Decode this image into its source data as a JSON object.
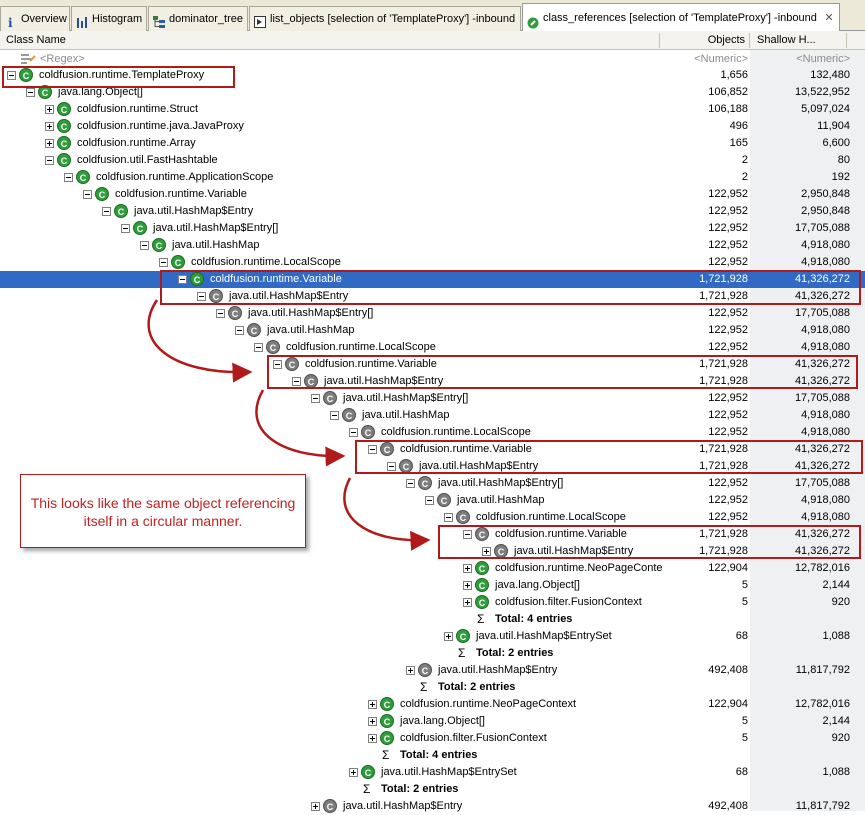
{
  "tabs": [
    {
      "label": "Overview",
      "icon": "info-icon"
    },
    {
      "label": "Histogram",
      "icon": "histogram-icon"
    },
    {
      "label": "dominator_tree",
      "icon": "tree-icon"
    },
    {
      "label": "list_objects [selection of 'TemplateProxy'] -inbound",
      "icon": "list-icon"
    },
    {
      "label": "class_references [selection of 'TemplateProxy'] -inbound",
      "icon": "class-references-icon",
      "active": true
    }
  ],
  "columns": {
    "class_name": "Class Name",
    "objects": "Objects",
    "shallow": "Shallow H..."
  },
  "filter": {
    "regex": "<Regex>",
    "objects": "<Numeric>",
    "shallow": "<Numeric>"
  },
  "rows": [
    {
      "type": "node",
      "indent": 0,
      "exp": "minus",
      "icon": "green",
      "name": "coldfusion.runtime.TemplateProxy",
      "objects": "1,656",
      "shallow": "132,480"
    },
    {
      "type": "node",
      "indent": 1,
      "exp": "minus",
      "icon": "green",
      "name": "java.lang.Object[]",
      "objects": "106,852",
      "shallow": "13,522,952"
    },
    {
      "type": "node",
      "indent": 2,
      "exp": "plus",
      "icon": "green",
      "name": "coldfusion.runtime.Struct",
      "objects": "106,188",
      "shallow": "5,097,024"
    },
    {
      "type": "node",
      "indent": 2,
      "exp": "plus",
      "icon": "green",
      "name": "coldfusion.runtime.java.JavaProxy",
      "objects": "496",
      "shallow": "11,904"
    },
    {
      "type": "node",
      "indent": 2,
      "exp": "plus",
      "icon": "green",
      "name": "coldfusion.runtime.Array",
      "objects": "165",
      "shallow": "6,600"
    },
    {
      "type": "node",
      "indent": 2,
      "exp": "minus",
      "icon": "green",
      "name": "coldfusion.util.FastHashtable",
      "objects": "2",
      "shallow": "80"
    },
    {
      "type": "node",
      "indent": 3,
      "exp": "minus",
      "icon": "green",
      "name": "coldfusion.runtime.ApplicationScope",
      "objects": "2",
      "shallow": "192"
    },
    {
      "type": "node",
      "indent": 4,
      "exp": "minus",
      "icon": "green",
      "name": "coldfusion.runtime.Variable",
      "objects": "122,952",
      "shallow": "2,950,848"
    },
    {
      "type": "node",
      "indent": 5,
      "exp": "minus",
      "icon": "green",
      "name": "java.util.HashMap$Entry",
      "objects": "122,952",
      "shallow": "2,950,848"
    },
    {
      "type": "node",
      "indent": 6,
      "exp": "minus",
      "icon": "green",
      "name": "java.util.HashMap$Entry[]",
      "objects": "122,952",
      "shallow": "17,705,088"
    },
    {
      "type": "node",
      "indent": 7,
      "exp": "minus",
      "icon": "green",
      "name": "java.util.HashMap",
      "objects": "122,952",
      "shallow": "4,918,080"
    },
    {
      "type": "node",
      "indent": 8,
      "exp": "minus",
      "icon": "green",
      "name": "coldfusion.runtime.LocalScope",
      "objects": "122,952",
      "shallow": "4,918,080"
    },
    {
      "type": "node",
      "indent": 9,
      "exp": "minus",
      "icon": "green",
      "name": "coldfusion.runtime.Variable",
      "objects": "1,721,928",
      "shallow": "41,326,272",
      "selected": true
    },
    {
      "type": "node",
      "indent": 10,
      "exp": "minus",
      "icon": "gray",
      "name": "java.util.HashMap$Entry",
      "objects": "1,721,928",
      "shallow": "41,326,272"
    },
    {
      "type": "node",
      "indent": 11,
      "exp": "minus",
      "icon": "gray",
      "name": "java.util.HashMap$Entry[]",
      "objects": "122,952",
      "shallow": "17,705,088"
    },
    {
      "type": "node",
      "indent": 12,
      "exp": "minus",
      "icon": "gray",
      "name": "java.util.HashMap",
      "objects": "122,952",
      "shallow": "4,918,080"
    },
    {
      "type": "node",
      "indent": 13,
      "exp": "minus",
      "icon": "gray",
      "name": "coldfusion.runtime.LocalScope",
      "objects": "122,952",
      "shallow": "4,918,080"
    },
    {
      "type": "node",
      "indent": 14,
      "exp": "minus",
      "icon": "gray",
      "name": "coldfusion.runtime.Variable",
      "objects": "1,721,928",
      "shallow": "41,326,272"
    },
    {
      "type": "node",
      "indent": 15,
      "exp": "minus",
      "icon": "gray",
      "name": "java.util.HashMap$Entry",
      "objects": "1,721,928",
      "shallow": "41,326,272"
    },
    {
      "type": "node",
      "indent": 16,
      "exp": "minus",
      "icon": "gray",
      "name": "java.util.HashMap$Entry[]",
      "objects": "122,952",
      "shallow": "17,705,088"
    },
    {
      "type": "node",
      "indent": 17,
      "exp": "minus",
      "icon": "gray",
      "name": "java.util.HashMap",
      "objects": "122,952",
      "shallow": "4,918,080"
    },
    {
      "type": "node",
      "indent": 18,
      "exp": "minus",
      "icon": "gray",
      "name": "coldfusion.runtime.LocalScope",
      "objects": "122,952",
      "shallow": "4,918,080"
    },
    {
      "type": "node",
      "indent": 19,
      "exp": "minus",
      "icon": "gray",
      "name": "coldfusion.runtime.Variable",
      "objects": "1,721,928",
      "shallow": "41,326,272"
    },
    {
      "type": "node",
      "indent": 20,
      "exp": "minus",
      "icon": "gray",
      "name": "java.util.HashMap$Entry",
      "objects": "1,721,928",
      "shallow": "41,326,272"
    },
    {
      "type": "node",
      "indent": 21,
      "exp": "minus",
      "icon": "gray",
      "name": "java.util.HashMap$Entry[]",
      "objects": "122,952",
      "shallow": "17,705,088"
    },
    {
      "type": "node",
      "indent": 22,
      "exp": "minus",
      "icon": "gray",
      "name": "java.util.HashMap",
      "objects": "122,952",
      "shallow": "4,918,080"
    },
    {
      "type": "node",
      "indent": 23,
      "exp": "minus",
      "icon": "gray",
      "name": "coldfusion.runtime.LocalScope",
      "objects": "122,952",
      "shallow": "4,918,080"
    },
    {
      "type": "node",
      "indent": 24,
      "exp": "minus",
      "icon": "gray",
      "name": "coldfusion.runtime.Variable",
      "objects": "1,721,928",
      "shallow": "41,326,272"
    },
    {
      "type": "node",
      "indent": 25,
      "exp": "plus",
      "icon": "gray",
      "name": "java.util.HashMap$Entry",
      "objects": "1,721,928",
      "shallow": "41,326,272"
    },
    {
      "type": "node",
      "indent": 24,
      "exp": "plus",
      "icon": "green",
      "name": "coldfusion.runtime.NeoPageConte",
      "objects": "122,904",
      "shallow": "12,782,016"
    },
    {
      "type": "node",
      "indent": 24,
      "exp": "plus",
      "icon": "green",
      "name": "java.lang.Object[]",
      "objects": "5",
      "shallow": "2,144"
    },
    {
      "type": "node",
      "indent": 24,
      "exp": "plus",
      "icon": "green",
      "name": "coldfusion.filter.FusionContext",
      "objects": "5",
      "shallow": "920"
    },
    {
      "type": "total",
      "indent": 24,
      "text": "Total: 4 entries"
    },
    {
      "type": "node",
      "indent": 23,
      "exp": "plus",
      "icon": "green",
      "name": "java.util.HashMap$EntrySet",
      "objects": "68",
      "shallow": "1,088"
    },
    {
      "type": "total",
      "indent": 23,
      "text": "Total: 2 entries"
    },
    {
      "type": "node",
      "indent": 21,
      "exp": "plus",
      "icon": "gray",
      "name": "java.util.HashMap$Entry",
      "objects": "492,408",
      "shallow": "11,817,792"
    },
    {
      "type": "total",
      "indent": 21,
      "text": "Total: 2 entries"
    },
    {
      "type": "node",
      "indent": 19,
      "exp": "plus",
      "icon": "green",
      "name": "coldfusion.runtime.NeoPageContext",
      "objects": "122,904",
      "shallow": "12,782,016"
    },
    {
      "type": "node",
      "indent": 19,
      "exp": "plus",
      "icon": "green",
      "name": "java.lang.Object[]",
      "objects": "5",
      "shallow": "2,144"
    },
    {
      "type": "node",
      "indent": 19,
      "exp": "plus",
      "icon": "green",
      "name": "coldfusion.filter.FusionContext",
      "objects": "5",
      "shallow": "920"
    },
    {
      "type": "total",
      "indent": 19,
      "text": "Total: 4 entries"
    },
    {
      "type": "node",
      "indent": 18,
      "exp": "plus",
      "icon": "green",
      "name": "java.util.HashMap$EntrySet",
      "objects": "68",
      "shallow": "1,088"
    },
    {
      "type": "total",
      "indent": 18,
      "text": "Total: 2 entries"
    },
    {
      "type": "node",
      "indent": 16,
      "exp": "plus",
      "icon": "gray",
      "name": "java.util.HashMap$Entry",
      "objects": "492,408",
      "shallow": "11,817,792"
    }
  ],
  "annotation": {
    "text": "This looks like the same object referencing itself in a circular manner."
  },
  "colors": {
    "annotation": "#b01a1a",
    "selection": "#316ac5"
  }
}
